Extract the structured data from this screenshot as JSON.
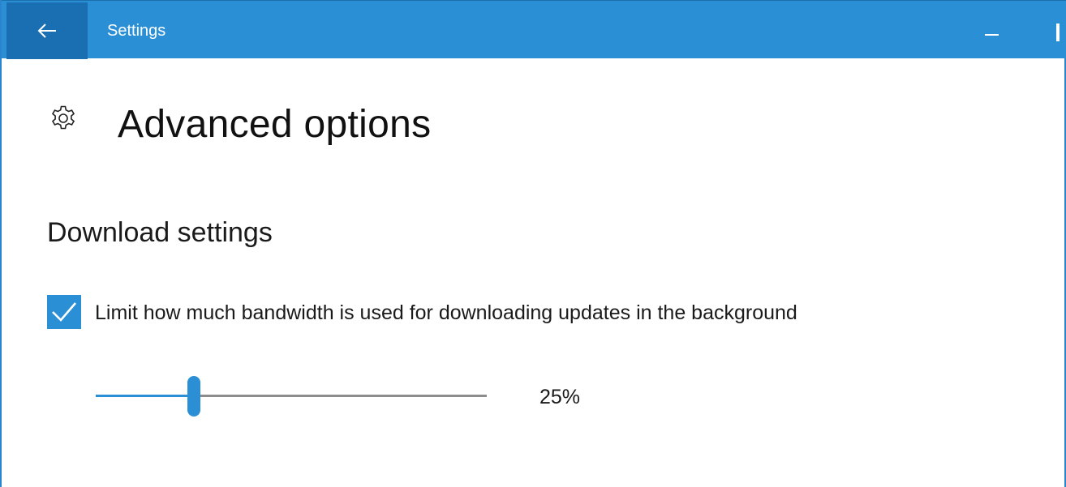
{
  "window": {
    "title": "Settings",
    "accent_color": "#2b8fd6",
    "back_icon": "arrow-left-icon",
    "minimize_icon": "minimize-icon"
  },
  "page": {
    "icon": "gear-icon",
    "title": "Advanced options"
  },
  "download_settings": {
    "heading": "Download settings",
    "limit_bandwidth": {
      "label": "Limit how much bandwidth is used for downloading updates in the background",
      "checked": true
    },
    "bandwidth_slider": {
      "value_percent": 25,
      "value_label": "25%"
    }
  }
}
